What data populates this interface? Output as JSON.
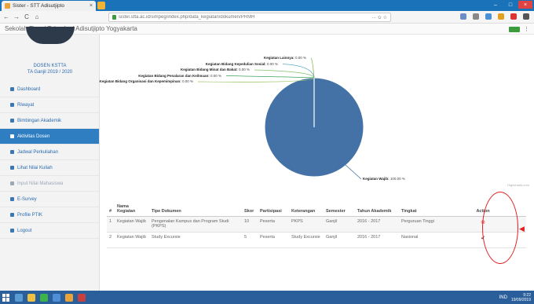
{
  "browser": {
    "tab_title": "Sister - STT Adisutjipto",
    "tab_close": "×",
    "url": "sister.stta.ac.id/simpeg/index.php/data_kegiatan/dokumen/PRMH",
    "zoom": "··· ✩ ☆",
    "nav": {
      "back": "←",
      "forward": "→",
      "reload": "C",
      "home": "⌂"
    },
    "bookmark_site": "Sekolah Tinggi Teknologi Adisutjipto Yogyakarta",
    "bookmark_menu": "⋮",
    "window": {
      "min": "–",
      "max": "□",
      "close": "×"
    }
  },
  "sidebar": {
    "user_id": "DOSEN KSTTA",
    "semester": "TA Ganjil 2019 / 2020",
    "items": [
      {
        "label": "Dashboard",
        "state": "normal"
      },
      {
        "label": "Riwayat",
        "state": "normal"
      },
      {
        "label": "Bimbingan Akademik",
        "state": "normal"
      },
      {
        "label": "Aktivitas Dosen",
        "state": "active"
      },
      {
        "label": "Jadwal Perkuliahan",
        "state": "normal"
      },
      {
        "label": "Lihat Nilai Kuliah",
        "state": "normal"
      },
      {
        "label": "Input Nilai Mahasiswa",
        "state": "dim"
      },
      {
        "label": "E-Survey",
        "state": "normal"
      },
      {
        "label": "Profile PTIK",
        "state": "normal"
      },
      {
        "label": "Logout",
        "state": "normal"
      }
    ]
  },
  "chart_data": {
    "type": "pie",
    "title": "",
    "slices": [
      {
        "name": "Kegiatan Wajib",
        "value": 100.0,
        "label": "100.00 %",
        "color": "#4472a6"
      },
      {
        "name": "Kegiatan Lainnya",
        "value": 0.0,
        "label": "0.00 %",
        "color": "#90b84e"
      },
      {
        "name": "Kegiatan Bidang Kepedulian Sosial",
        "value": 0.0,
        "label": "0.00 %",
        "color": "#5aa9c9"
      },
      {
        "name": "Kegiatan Bidang Minat dan Bakat",
        "value": 0.0,
        "label": "0.00 %",
        "color": "#7ec06b"
      },
      {
        "name": "Kegiatan Bidang Penalaran dan Keilmuan",
        "value": 0.0,
        "label": "0.00 %",
        "color": "#3f9f5f"
      },
      {
        "name": "Kegiatan Bidang Organisasi dan Kepemimpinan",
        "value": 0.0,
        "label": "0.00 %",
        "color": "#a0c76a"
      }
    ],
    "credits": "Highcharts.com"
  },
  "table": {
    "headers": [
      "#",
      "Nama Kegiatan",
      "Tipe Dokumen",
      "Skor",
      "Partisipasi",
      "Keterangan",
      "Semester",
      "Tahun Akademik",
      "Tingkat",
      "Action"
    ],
    "rows": [
      {
        "no": "1",
        "kegiatan": "Kegiatan Wajib",
        "tipe": "Pengenalan Kampus dan Program Studi (PKPS)",
        "skor": "10",
        "partisipasi": "Peserta",
        "keterangan": "PKPS",
        "semester": "Ganjil",
        "tahun": "2016 - 2017",
        "tingkat": "Perguruan Tinggi",
        "action_icon": "delete-icon",
        "action_glyph": "⊗"
      },
      {
        "no": "2",
        "kegiatan": "Kegiatan Wajib",
        "tipe": "Study Excursie",
        "skor": "5",
        "partisipasi": "Peserta",
        "keterangan": "Study Excursie",
        "semester": "Ganjil",
        "tahun": "2016 - 2017",
        "tingkat": "Nasional",
        "action_icon": "edit-icon",
        "action_glyph": "✔"
      }
    ]
  },
  "annotation_arrow": "◀",
  "taskbar": {
    "tray_text": "IND",
    "clock_time": "9:22",
    "clock_date": "19/09/2019"
  },
  "colors": {
    "accent": "#2f7ec1",
    "pie_main": "#4472a6",
    "annotation": "#e31f1f"
  }
}
